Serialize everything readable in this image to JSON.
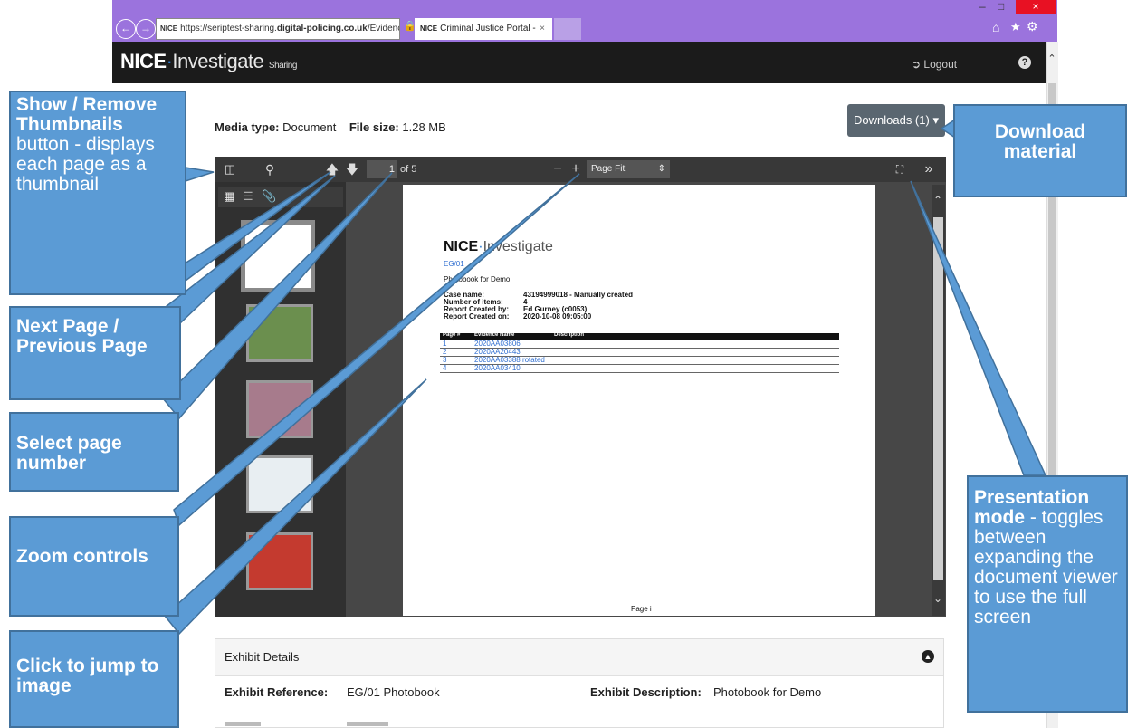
{
  "browser": {
    "url_plain": "https://seriptest-sharing.",
    "url_bold": "digital-policing.co.uk",
    "url_rest": "/Evidence",
    "url_badge": "NICE",
    "tab_badge": "NICE",
    "tab_title": "Criminal Justice Portal -",
    "tab_close": "×",
    "win_close": "×"
  },
  "app": {
    "logo_bold": "NICE",
    "logo_dot": "·",
    "logo_light": "Investigate",
    "logo_small": "Sharing",
    "logout": "Logout"
  },
  "content": {
    "media_type_label": "Media type:",
    "media_type_value": "Document",
    "file_size_label": "File size:",
    "file_size_value": "1.28 MB",
    "downloads": "Downloads (1)"
  },
  "viewer": {
    "page_number": "1",
    "page_of": "of 5",
    "zoom": "Page Fit",
    "doc_title_bold": "NICE",
    "doc_title_light": "Investigate",
    "doc_ref": "EG/01",
    "doc_subtitle": "Photobook for Demo",
    "meta_labels": [
      "Case name:",
      "Number of items:",
      "Report Created by:",
      "Report Created on:"
    ],
    "meta_values": [
      "43194999018 - Manually created",
      "4",
      "Ed Gurney (c0053)",
      "2020-10-08 09:05:00"
    ],
    "table_headers": [
      "Page #",
      "Evidence Name",
      "Description"
    ],
    "rows": [
      {
        "page": "1",
        "name": "2020AA03806"
      },
      {
        "page": "2",
        "name": "2020AA20443"
      },
      {
        "page": "3",
        "name": "2020AA03388 rotated"
      },
      {
        "page": "4",
        "name": "2020AA03410"
      }
    ],
    "footer": "Page i"
  },
  "exhibit": {
    "heading": "Exhibit Details",
    "ref_label": "Exhibit Reference:",
    "ref_value": "EG/01 Photobook",
    "desc_label": "Exhibit Description:",
    "desc_value": "Photobook for Demo"
  },
  "callouts": {
    "thumbnails_bold": "Show / Remove Thumbnails",
    "thumbnails_text": "button - displays each page as a thumbnail",
    "next_prev": "Next Page / Previous Page",
    "select_page": "Select page number",
    "zoom": "Zoom controls",
    "jump": "Click to jump to image",
    "download": "Download material",
    "presentation_bold": "Presentation mode",
    "presentation_text": "- toggles between expanding the document viewer to use the full screen"
  }
}
